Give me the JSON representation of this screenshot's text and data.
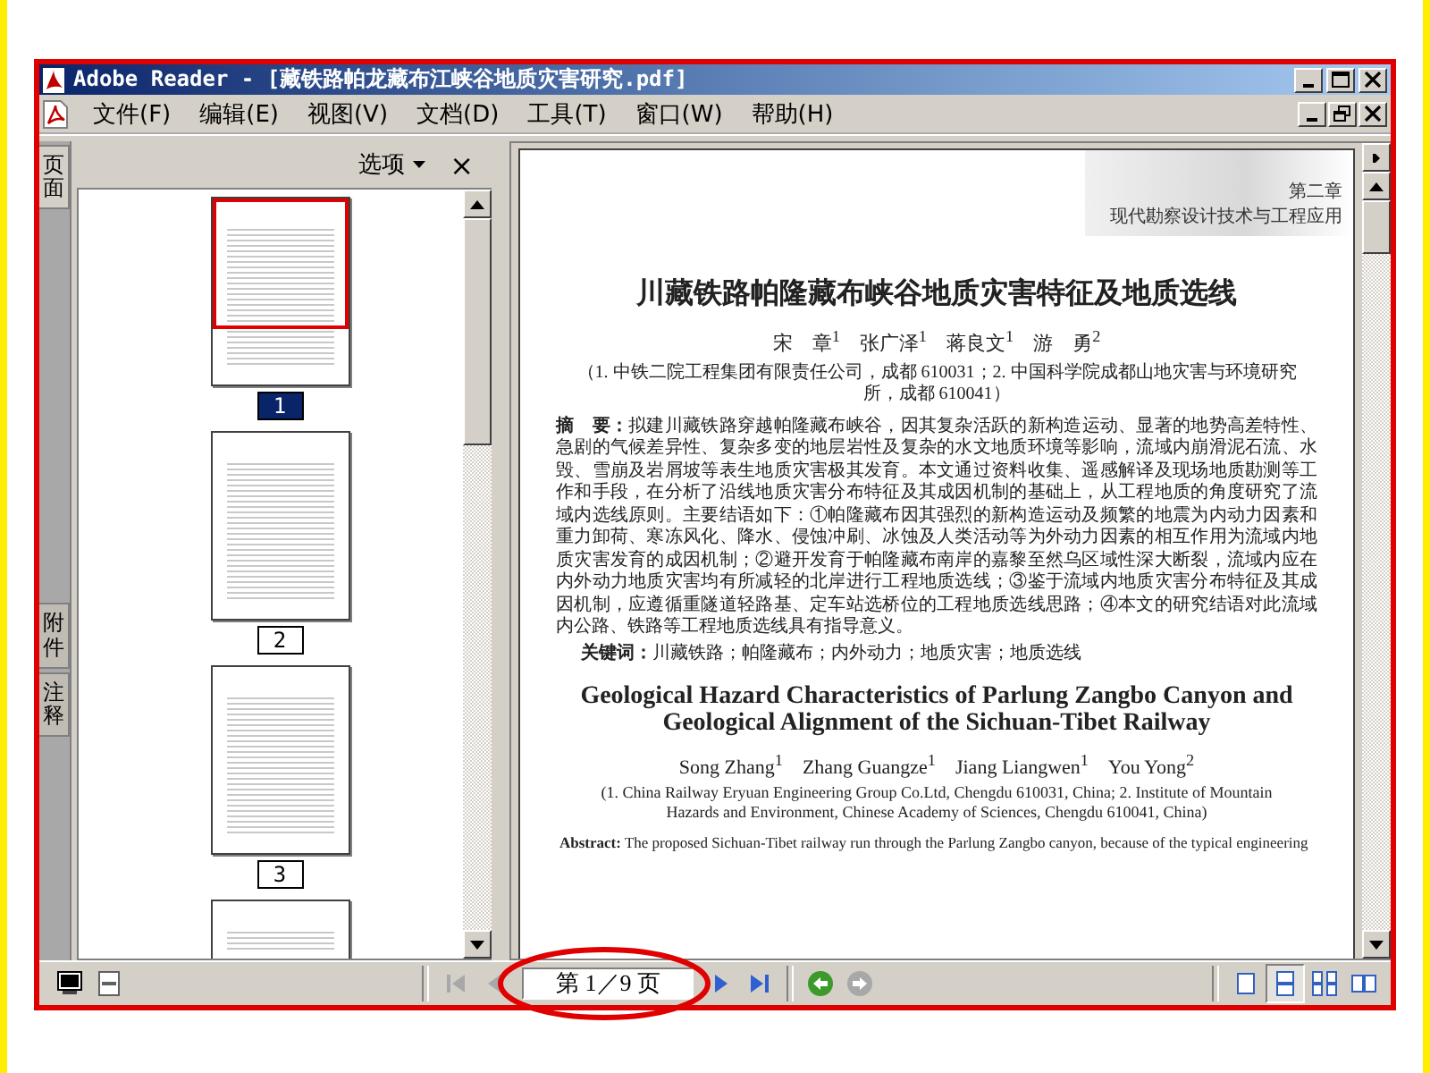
{
  "window": {
    "title": "Adobe Reader - [藏铁路帕龙藏布江峡谷地质灾害研究.pdf]"
  },
  "menu": [
    "文件(F)",
    "编辑(E)",
    "视图(V)",
    "文档(D)",
    "工具(T)",
    "窗口(W)",
    "帮助(H)"
  ],
  "side_tabs": [
    {
      "label": "页面",
      "selected": true
    },
    {
      "label": "附件",
      "selected": false
    },
    {
      "label": "注释",
      "selected": false
    }
  ],
  "panel": {
    "options_label": "选项",
    "close_label": "×"
  },
  "thumbnails": [
    {
      "label": "1",
      "selected": true
    },
    {
      "label": "2",
      "selected": false
    },
    {
      "label": "3",
      "selected": false
    }
  ],
  "document": {
    "chapter": "第二章",
    "book_title": "现代勘察设计技术与工程应用",
    "title_zh": "川藏铁路帕隆藏布峡谷地质灾害特征及地质选线",
    "authors_zh": "宋　章$^{1}$　张广泽$^{1}$　蒋良文$^{1}$　游　勇$^{2}$",
    "affiliation_zh": "（1. 中铁二院工程集团有限责任公司，成都 610031；2. 中国科学院成都山地灾害与环境研究所，成都 610041）",
    "abstract_zh": "**摘　要：**拟建川藏铁路穿越帕隆藏布峡谷，因其复杂活跃的新构造运动、显著的地势高差特性、急剧的气候差异性、复杂多变的地层岩性及复杂的水文地质环境等影响，流域内崩滑泥石流、水毁、雪崩及岩屑坡等表生地质灾害极其发育。本文通过资料收集、遥感解译及现场地质勘测等工作和手段，在分析了沿线地质灾害分布特征及其成因机制的基础上，从工程地质的角度研究了流域内选线原则。主要结语如下：①帕隆藏布因其强烈的新构造运动及频繁的地震为内动力因素和重力卸荷、寒冻风化、降水、侵蚀冲刷、冰蚀及人类活动等为外动力因素的相互作用为流域内地质灾害发育的成因机制；②避开发育于帕隆藏布南岸的嘉黎至然乌区域性深大断裂，流域内应在内外动力地质灾害均有所减轻的北岸进行工程地质选线；③鉴于流域内地质灾害分布特征及其成因机制，应遵循重隧道轻路基、定车站选桥位的工程地质选线思路；④本文的研究结语对此流域内公路、铁路等工程地质选线具有指导意义。",
    "keywords_zh": "**关键词：**川藏铁路；帕隆藏布；内外动力；地质灾害；地质选线",
    "title_en": "Geological Hazard Characteristics of Parlung Zangbo Canyon and Geological Alignment of the Sichuan-Tibet Railway",
    "authors_en": "Song Zhang$^{1}$　Zhang Guangze$^{1}$　Jiang Liangwen$^{1}$　You Yong$^{2}$",
    "affiliation_en": "(1. China Railway Eryuan Engineering Group Co.Ltd, Chengdu 610031, China; 2. Institute of Mountain Hazards and Environment, Chinese Academy of Sciences, Chengdu 610041, China)",
    "abstract_en": "**Abstract:** The proposed Sichuan-Tibet railway run through the Parlung Zangbo canyon, because of the typical engineering"
  },
  "nav_buttons": [
    {
      "kind": "first",
      "disabled": true
    },
    {
      "kind": "prev",
      "disabled": true
    },
    {
      "kind": "field"
    },
    {
      "kind": "next",
      "disabled": false
    },
    {
      "kind": "last",
      "disabled": false
    },
    {
      "kind": "back",
      "disabled": false
    },
    {
      "kind": "forward",
      "disabled": true
    }
  ],
  "page_field": {
    "value": "第 1／9 页"
  },
  "layout_buttons": [
    {
      "kind": "single",
      "selected": false
    },
    {
      "kind": "continuous",
      "selected": true
    },
    {
      "kind": "continuous-facing",
      "selected": false
    },
    {
      "kind": "facing",
      "selected": false
    }
  ]
}
